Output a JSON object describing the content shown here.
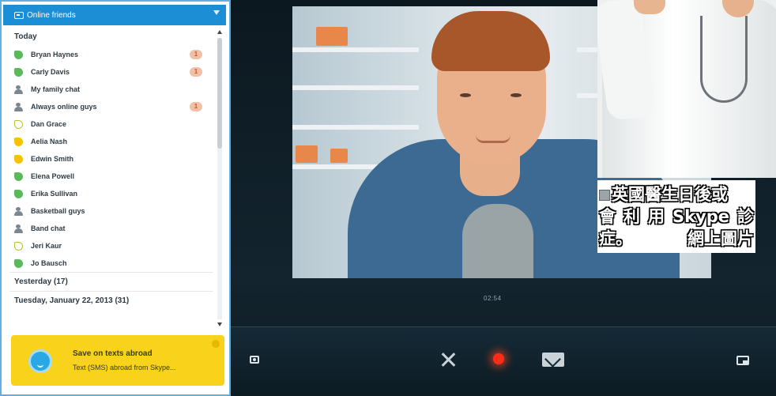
{
  "sidebar": {
    "header_title": "Online friends",
    "sections": {
      "today": "Today",
      "yesterday": "Yesterday (17)",
      "tuesday": "Tuesday, January 22, 2013 (31)"
    },
    "contacts": [
      {
        "name": "Bryan Haynes",
        "status": "online",
        "badge": "1"
      },
      {
        "name": "Carly Davis",
        "status": "online",
        "badge": "1"
      },
      {
        "name": "My family chat",
        "status": "group",
        "badge": ""
      },
      {
        "name": "Always online guys",
        "status": "group",
        "badge": "1"
      },
      {
        "name": "Dan Grace",
        "status": "offline",
        "badge": ""
      },
      {
        "name": "Aelia Nash",
        "status": "away",
        "badge": ""
      },
      {
        "name": "Edwin Smith",
        "status": "away",
        "badge": ""
      },
      {
        "name": "Elena Powell",
        "status": "online",
        "badge": ""
      },
      {
        "name": "Erika Sullivan",
        "status": "online",
        "badge": ""
      },
      {
        "name": "Basketball guys",
        "status": "group",
        "badge": ""
      },
      {
        "name": "Band chat",
        "status": "group",
        "badge": ""
      },
      {
        "name": "Jeri Kaur",
        "status": "offline",
        "badge": ""
      },
      {
        "name": "Jo Bausch",
        "status": "online",
        "badge": ""
      }
    ],
    "promo": {
      "title": "Save on texts abroad",
      "text": "Text (SMS) abroad from Skype..."
    }
  },
  "call": {
    "timer": "02:54"
  },
  "caption": {
    "line1": "英國醫生日後或",
    "line2": [
      "會",
      "利",
      "用",
      "Skype",
      "診"
    ],
    "line3_left": "症。",
    "line3_right": "網上圖片"
  },
  "colors": {
    "accent": "#1c8ed6",
    "promo": "#f9d21b",
    "record": "#ff2d17",
    "call_bg": "#0e1a22"
  }
}
